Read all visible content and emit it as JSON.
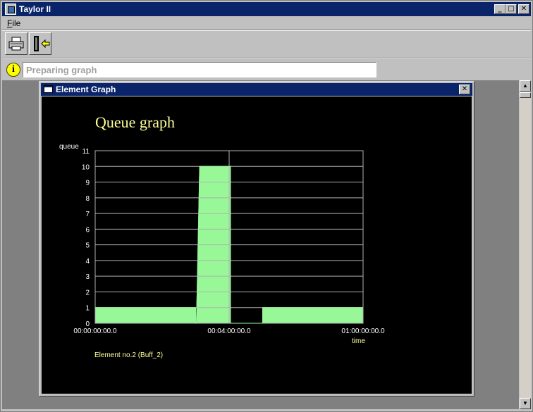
{
  "window": {
    "title": "Taylor II",
    "minimize_glyph": "_",
    "maximize_glyph": "□",
    "close_glyph": "✕"
  },
  "menu": {
    "file_label": "File",
    "file_mnemonic": "F",
    "file_rest": "ile"
  },
  "toolbar": {
    "print_icon": "printer-icon",
    "exit_icon": "exit-door-icon"
  },
  "status": {
    "icon_glyph": "i",
    "message": "Preparing graph"
  },
  "scrollbar": {
    "up_glyph": "▲",
    "down_glyph": "▼"
  },
  "child_window": {
    "title": "Element Graph",
    "close_glyph": "✕"
  },
  "colors": {
    "titlebar": "#0a246a",
    "graph_background": "#000000",
    "series": "#98f898",
    "text_yellow": "#ffff99",
    "grid": "#b0b0b0"
  },
  "chart_data": {
    "type": "area",
    "title": "Queue graph",
    "ylabel": "queue",
    "xlabel": "time",
    "ylim": [
      0,
      11
    ],
    "yticks": [
      "0",
      "1",
      "2",
      "3",
      "4",
      "5",
      "6",
      "7",
      "8",
      "9",
      "10",
      "11"
    ],
    "xtick_labels": [
      "00:00:00:00.0",
      "00:04:00:00.0",
      "01:00:00:00.0"
    ],
    "x_range_fraction": [
      0,
      1
    ],
    "series": [
      {
        "points": [
          [
            0.0,
            1
          ],
          [
            0.375,
            1
          ],
          [
            0.375,
            0
          ],
          [
            0.378,
            0
          ],
          [
            0.39,
            10
          ],
          [
            0.505,
            10
          ],
          [
            0.505,
            0
          ],
          [
            0.53,
            0
          ],
          [
            0.53,
            0
          ],
          [
            0.625,
            0
          ],
          [
            0.625,
            1
          ],
          [
            1.0,
            1
          ]
        ]
      }
    ],
    "marker_x_fraction": 0.5,
    "footer_note": "Element no.2 (Buff_2)"
  }
}
